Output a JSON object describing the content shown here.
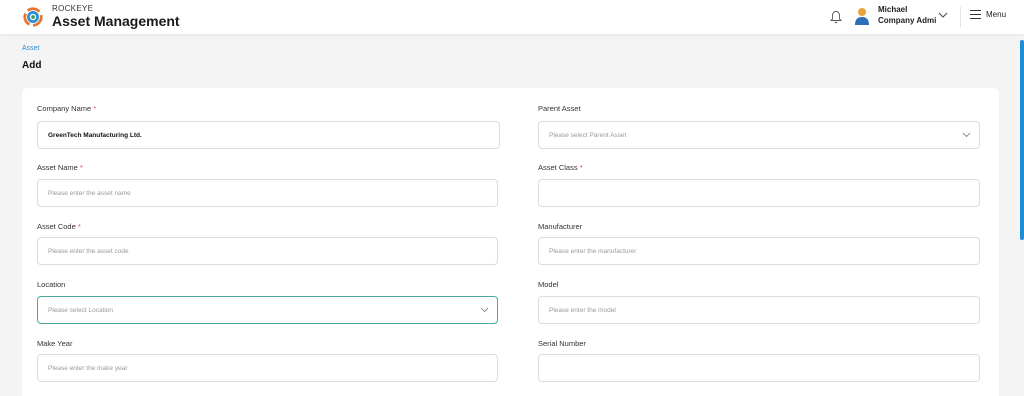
{
  "header": {
    "brand_small": "ROCKEYE",
    "brand_big": "Asset Management",
    "user_name": "Michael",
    "user_role": "Company Admi",
    "menu_label": "Menu"
  },
  "breadcrumb": "Asset",
  "page_title": "Add",
  "form": {
    "company_name": {
      "label": "Company Name",
      "required": "*",
      "value": "GreenTech Manufacturing Ltd."
    },
    "parent_asset": {
      "label": "Parent Asset",
      "placeholder": "Please select Parent Asset"
    },
    "asset_name": {
      "label": "Asset Name",
      "required": "*",
      "placeholder": "Please enter the asset name"
    },
    "asset_class": {
      "label": "Asset Class",
      "required": "*",
      "placeholder": ""
    },
    "asset_code": {
      "label": "Asset Code",
      "required": "*",
      "placeholder": "Please enter the asset code"
    },
    "manufacturer": {
      "label": "Manufacturer",
      "placeholder": "Please enter the manufacturer"
    },
    "location": {
      "label": "Location",
      "placeholder": "Please select Location"
    },
    "model": {
      "label": "Model",
      "placeholder": "Please enter the model"
    },
    "make_year": {
      "label": "Make Year",
      "placeholder": "Please enter the make year"
    },
    "serial_number": {
      "label": "Serial Number",
      "placeholder": ""
    }
  },
  "colors": {
    "accent": "#2a8fd6",
    "required": "#e54848",
    "focus_border": "#4aa89c",
    "background": "#f4f4f4"
  },
  "icons": [
    "logo-icon",
    "bell-icon",
    "avatar-icon",
    "chevron-down-icon",
    "hamburger-icon"
  ]
}
